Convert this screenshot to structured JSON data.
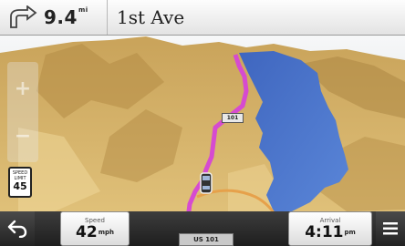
{
  "top_bar": {
    "turn_icon": "turn-right-arrow-icon",
    "distance": "9.4",
    "distance_unit": "mi",
    "street": "1st Ave"
  },
  "zoom": {
    "in_icon": "zoom-in-icon",
    "out_icon": "zoom-out-icon"
  },
  "speed_limit": {
    "caption": "SPEED LIMIT",
    "value": "45"
  },
  "bottom_bar": {
    "back_icon": "back-arrow-icon",
    "speed_caption": "Speed",
    "speed_value": "42",
    "speed_unit": "mph",
    "road_name": "US 101",
    "arrival_caption": "Arrival",
    "arrival_value": "4:11",
    "arrival_unit": "pm",
    "menu_icon": "menu-icon"
  },
  "map": {
    "road_sign": "101",
    "colors": {
      "terrain": "#d8b76e",
      "water": "#4a74c9",
      "route": "#d64bd0",
      "road": "#e9a34a",
      "sky": "#fafafa"
    }
  }
}
